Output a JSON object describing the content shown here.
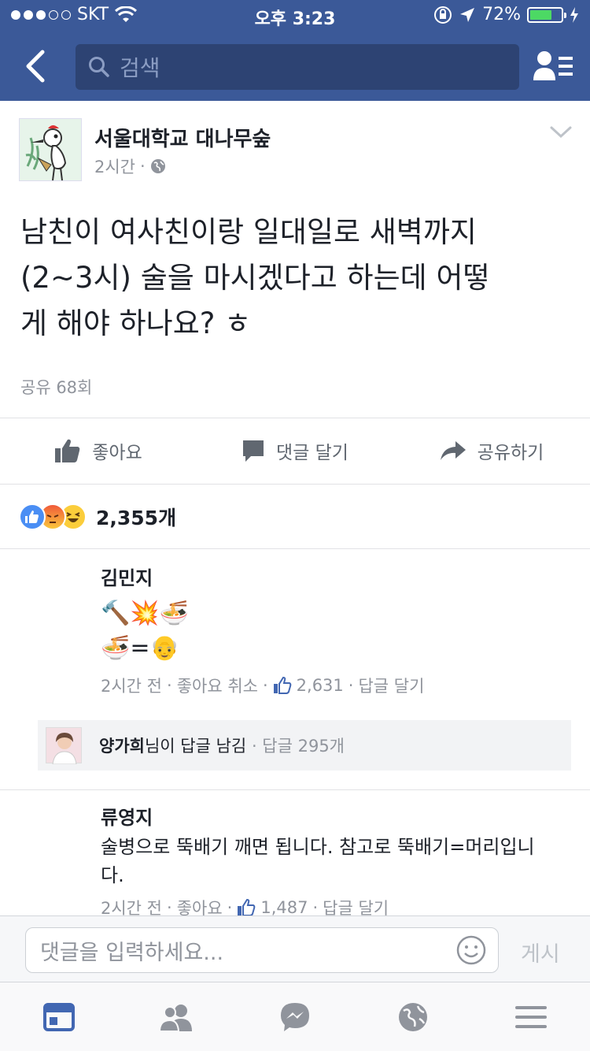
{
  "status_bar": {
    "carrier": "SKT",
    "time": "오후 3:23",
    "battery": "72%",
    "battery_level": 0.72
  },
  "nav": {
    "search_placeholder": "검색"
  },
  "post": {
    "page_name": "서울대학교 대나무숲",
    "time": "2시간",
    "dot": "·",
    "lines": [
      "남친이 여사친이랑 일대일로 새벽까지",
      "(2~3시) 술을 마시겠다고 하는데 어떻",
      "게 해야 하나요? ㅎ"
    ],
    "share_count": "공유 68회"
  },
  "actions": {
    "like": "좋아요",
    "comment": "댓글 달기",
    "share": "공유하기"
  },
  "reactions": {
    "count": "2,355개",
    "types": [
      "like",
      "angry",
      "haha"
    ]
  },
  "comments": [
    {
      "name": "김민지",
      "line1": "🔨💥🍜",
      "line2": "🍜=👴",
      "time": "2시간 전",
      "like_action": "좋아요 취소",
      "likes": "2,631",
      "reply_action": "답글 달기"
    },
    {
      "name": "류영지",
      "line1": "술병으로 뚝배기 깨면 됩니다. 참고로 뚝배기=머리입니",
      "line2": "다.",
      "time": "2시간 전",
      "like_action": "좋아요",
      "likes": "1,487",
      "reply_action": "답글 달기"
    }
  ],
  "reply_summary": {
    "name": "양가희",
    "text": "님이 답글 남김",
    "count": "· 답글 295개"
  },
  "input_bar": {
    "placeholder": "댓글을 입력하세요...",
    "post_label": "게시"
  },
  "tabs": [
    "news-feed",
    "friends",
    "messenger",
    "notifications",
    "menu"
  ],
  "colors": {
    "facebook_blue": "#3b5998",
    "search_bg": "#2d4373",
    "muted_text": "#90949c",
    "active_tab": "#4267b2"
  }
}
